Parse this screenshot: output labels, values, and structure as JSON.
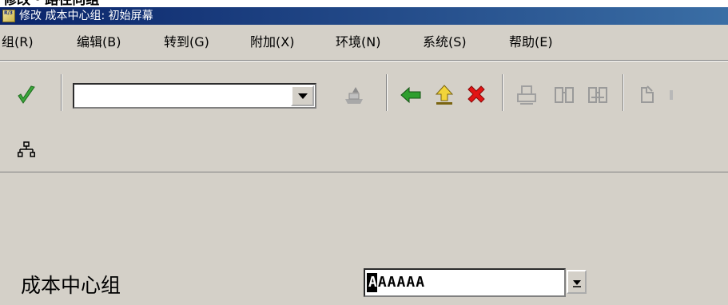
{
  "crop_caption": "修改 · 路径向组",
  "window": {
    "title": "修改 成本中心组: 初始屏幕",
    "logo_text": "R/3"
  },
  "menu": [
    {
      "label": "组(R)"
    },
    {
      "label": "编辑(B)"
    },
    {
      "label": "转到(G)"
    },
    {
      "label": "附加(X)"
    },
    {
      "label": "环境(N)"
    },
    {
      "label": "系统(S)"
    },
    {
      "label": "帮助(E)"
    }
  ],
  "toolbar": {
    "command_field_value": "",
    "icons": [
      "enter-check-icon",
      "save-icon",
      "back-arrow-icon",
      "exit-up-icon",
      "cancel-x-icon",
      "print-icon",
      "find-icon",
      "find-next-icon",
      "first-page-icon"
    ]
  },
  "app_toolbar": {
    "icons": [
      "hierarchy-icon"
    ]
  },
  "form": {
    "field_label": "成本中心组",
    "field_value": "AAAAAA",
    "cursor_char": "A"
  },
  "colors": {
    "title_bar_start": "#0a246a",
    "title_bar_end": "#3a6ea5",
    "window_bg": "#d4d0c8",
    "check_green": "#3aa63a",
    "arrow_green": "#2e9e2e",
    "up_yellow": "#f2d43a",
    "cancel_red": "#e21414"
  }
}
